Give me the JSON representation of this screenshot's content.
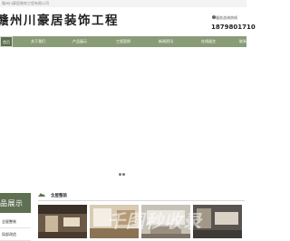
{
  "top_bar": {
    "text": "赣州川豪居装饰工程有限公司"
  },
  "header": {
    "brand": "赣州川豪居装饰工程",
    "hotline_label": "服务咨询热线",
    "hotline_number": "1879801710"
  },
  "nav": {
    "items": [
      {
        "label": "首页"
      },
      {
        "label": "关于我们"
      },
      {
        "label": "产品展示"
      },
      {
        "label": "工程案例"
      },
      {
        "label": "新闻资讯"
      },
      {
        "label": "在线留言"
      },
      {
        "label": "联系我们"
      }
    ]
  },
  "banner": {
    "dots": 2
  },
  "sidebar": {
    "title": "品展示",
    "items": [
      {
        "label": "全屋整装"
      },
      {
        "label": "局部改造"
      }
    ]
  },
  "section": {
    "title": "全屋整装"
  },
  "watermark": "千图秒收录",
  "colors": {
    "nav_bg": "#8a9b78",
    "nav_active": "#5f6f52",
    "sidebar_head": "#5f6f52"
  }
}
